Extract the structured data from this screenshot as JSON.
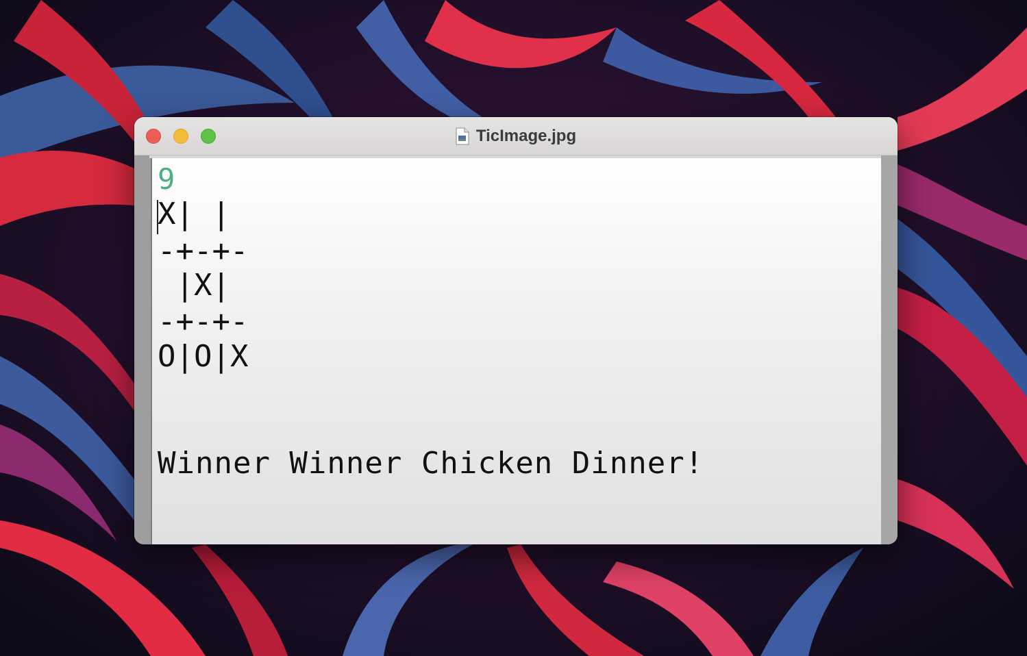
{
  "window": {
    "title": "TicImage.jpg",
    "file_icon": "image-file-icon"
  },
  "terminal": {
    "turn_count": "9",
    "board": {
      "row1": "X| |",
      "sep1": "-+-+-",
      "row2": " |X|",
      "sep2": "-+-+-",
      "row3": "O|O|X"
    },
    "message": "Winner Winner Chicken Dinner!"
  },
  "colors": {
    "turn_count": "#4cae80",
    "close": "#ec5f57",
    "minimize": "#f3bd39",
    "zoom": "#5ec245"
  }
}
